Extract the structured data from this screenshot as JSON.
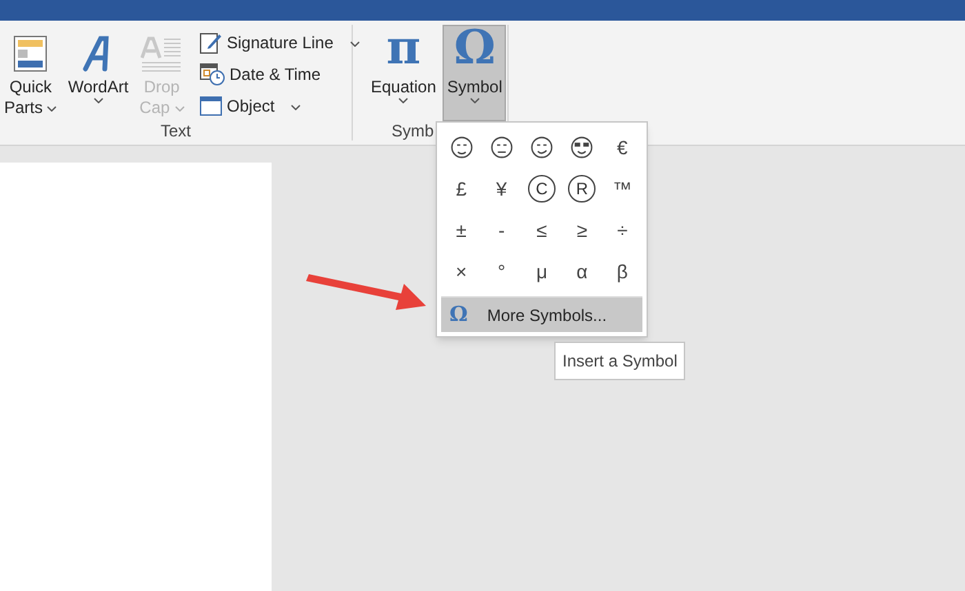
{
  "ribbon": {
    "groups": [
      {
        "label": "Text",
        "large_buttons": [
          {
            "kind": "quickparts",
            "lines": [
              "Quick",
              "Parts"
            ],
            "dropdown": true,
            "disabled": false
          },
          {
            "kind": "wordart",
            "lines": [
              "WordArt"
            ],
            "dropdown": true,
            "disabled": false
          },
          {
            "kind": "dropcap",
            "lines": [
              "Drop",
              "Cap"
            ],
            "dropdown": true,
            "disabled": true
          }
        ],
        "small_buttons": [
          {
            "kind": "signature",
            "label": "Signature Line",
            "dropdown": true
          },
          {
            "kind": "datetime",
            "label": "Date & Time",
            "dropdown": false
          },
          {
            "kind": "object",
            "label": "Object",
            "dropdown": true
          }
        ]
      },
      {
        "label": "Symb",
        "large_buttons": [
          {
            "kind": "equation",
            "glyph": "π",
            "lines": [
              "Equation"
            ],
            "dropdown": true,
            "disabled": false,
            "selected": false
          },
          {
            "kind": "symbol",
            "glyph": "Ω",
            "lines": [
              "Symbol"
            ],
            "dropdown": true,
            "disabled": false,
            "selected": true
          }
        ]
      }
    ]
  },
  "symbol_menu": {
    "symbols": [
      {
        "kind": "face"
      },
      {
        "kind": "face"
      },
      {
        "kind": "face"
      },
      {
        "kind": "face"
      },
      {
        "kind": "text",
        "text": "€"
      },
      {
        "kind": "text",
        "text": "£"
      },
      {
        "kind": "text",
        "text": "¥"
      },
      {
        "kind": "circled",
        "text": "C"
      },
      {
        "kind": "circled",
        "text": "R"
      },
      {
        "kind": "text",
        "text": "™"
      },
      {
        "kind": "text",
        "text": "±"
      },
      {
        "kind": "text",
        "text": "-"
      },
      {
        "kind": "text",
        "text": "≤"
      },
      {
        "kind": "text",
        "text": "≥"
      },
      {
        "kind": "text",
        "text": "÷"
      },
      {
        "kind": "text",
        "text": "×"
      },
      {
        "kind": "text",
        "text": "°"
      },
      {
        "kind": "text",
        "text": "μ"
      },
      {
        "kind": "text",
        "text": "α"
      },
      {
        "kind": "text",
        "text": "β"
      }
    ],
    "more": {
      "glyph": "Ω",
      "label": "More Symbols...",
      "selected": true
    }
  },
  "tooltip": "Insert a Symbol"
}
